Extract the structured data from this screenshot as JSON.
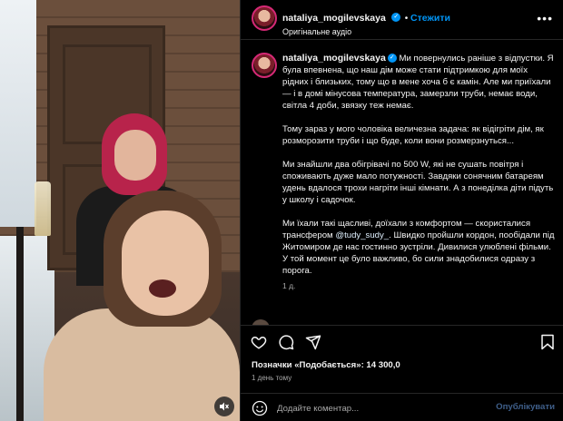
{
  "post": {
    "username": "nataliya_mogilevskaya",
    "follow_label": "Стежити",
    "audio_label": "Оригінальне аудіо",
    "more_icon": "more-dots-icon"
  },
  "caption": {
    "username": "nataliya_mogilevskaya",
    "p1": "Ми повернулись раніше з відпустки. Я була впевнена, що наш дім може стати підтримкою для моїх рідних і близьких, тому що в мене хоча б є камін. Але ми приїхали — і в домі мінусова температура, замерзли труби, немає води, світла 4 доби, звязку теж немає.",
    "p2": "Тому зараз у мого чоловіка величезна задача: як відігріти дім, як розморозити труби і що буде, коли вони розмерзнуться...",
    "p3": "Ми знайшли два обігрівачі по 500 W, які не сушать повітря і споживають дуже мало потужності. Завдяки сонячним батареям удень вдалося трохи нагріти інші кімнати. А з понеділка діти підуть у школу і садочок.",
    "p4a": "Ми їхали такі щасливі, доїхали з комфортом — скористалися трансфером ",
    "p4_mention": "@tudy_sudy_",
    "p4b": ". Швидко пройшли кордон, пообідали під Житомиром де нас гостинно зустріли. Дивилися улюблені фільми.",
    "p4c": "У той момент це було важливо, бо сили знадобилися одразу з порога.",
    "time_ago": "1 д."
  },
  "actions": {
    "icons": [
      "heart-icon",
      "comment-icon",
      "share-icon",
      "bookmark-icon"
    ],
    "likes_text": "Позначки «Подобається»: 14 300,0",
    "date_text": "1 день тому"
  },
  "comment_bar": {
    "placeholder": "Додайте коментар...",
    "publish_label": "Опублікувати"
  },
  "colors": {
    "accent": "#0095f6",
    "background": "#000000",
    "text": "#f5f5f5",
    "muted": "#a8a8a8"
  }
}
